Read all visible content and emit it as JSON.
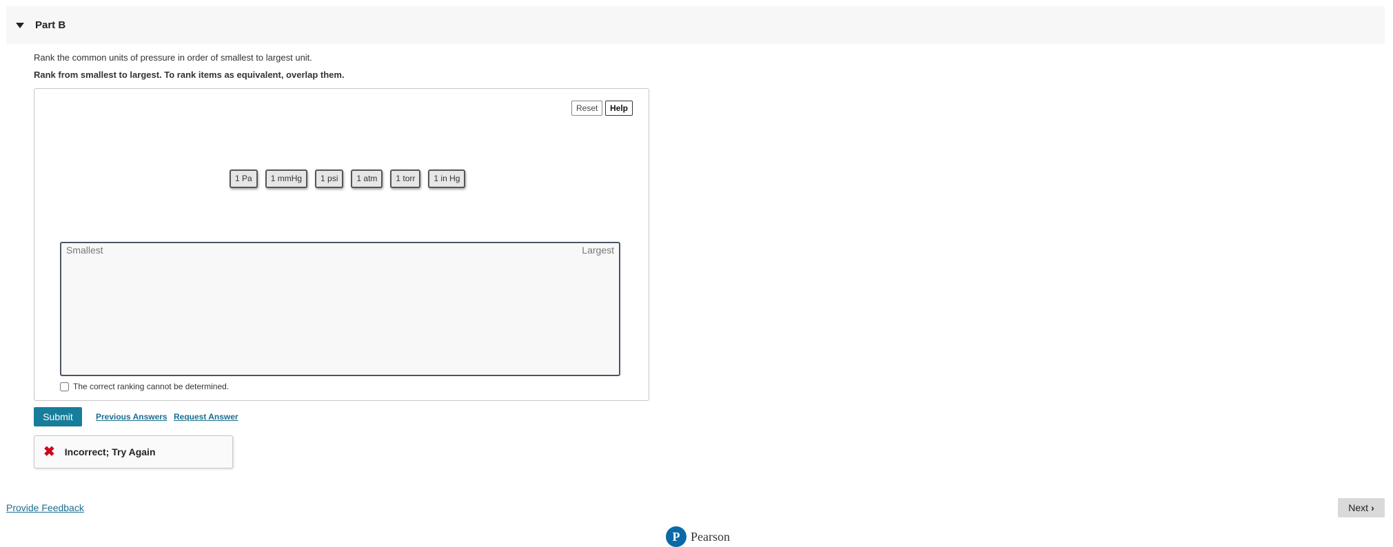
{
  "part": {
    "title": "Part B"
  },
  "question": {
    "text": "Rank the common units of pressure in order of smallest to largest unit.",
    "instruction": "Rank from smallest to largest. To rank items as equivalent, overlap them."
  },
  "ranking": {
    "reset_label": "Reset",
    "help_label": "Help",
    "items": [
      "1 Pa",
      "1 mmHg",
      "1 psi",
      "1 atm",
      "1 torr",
      "1 in Hg"
    ],
    "smallest_label": "Smallest",
    "largest_label": "Largest",
    "cannot_determine_label": "The correct ranking cannot be determined."
  },
  "actions": {
    "submit_label": "Submit",
    "previous_answers_label": "Previous Answers",
    "request_answer_label": "Request Answer"
  },
  "feedback": {
    "message": "Incorrect; Try Again"
  },
  "footer": {
    "provide_feedback_label": "Provide Feedback",
    "next_label": "Next",
    "brand": "Pearson"
  },
  "colors": {
    "submit_bg": "#167d9a",
    "link": "#1a6e91",
    "error": "#d0021b"
  }
}
